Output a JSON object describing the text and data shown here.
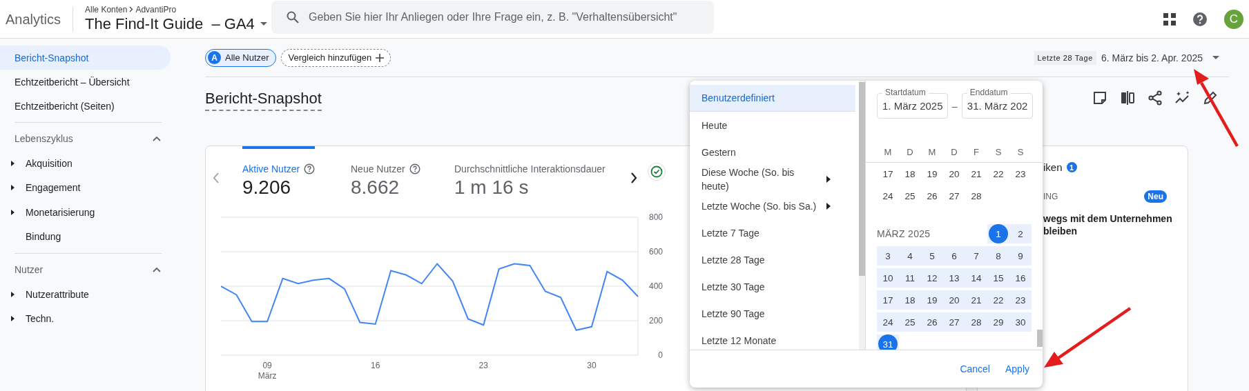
{
  "header": {
    "product": "Analytics",
    "breadcrumb": [
      "Alle Konten",
      "AdvantiPro"
    ],
    "property": "The Find-It Guide  – GA4",
    "search": {
      "placeholder": "Geben Sie hier Ihr Anliegen oder Ihre Frage ein, z. B. \"Verhaltensübersicht\""
    },
    "avatar": "C"
  },
  "sidebar": {
    "items": [
      {
        "label": "Bericht-Snapshot",
        "selected": true
      },
      {
        "label": "Echtzeitbericht – Übersicht",
        "selected": false
      },
      {
        "label": "Echtzeitbericht (Seiten)",
        "selected": false
      }
    ],
    "sections": [
      {
        "title": "Lebenszyklus",
        "expanded": true,
        "items": [
          {
            "label": "Akquisition",
            "expandable": true
          },
          {
            "label": "Engagement",
            "expandable": true
          },
          {
            "label": "Monetarisierung",
            "expandable": true
          },
          {
            "label": "Bindung",
            "expandable": false
          }
        ]
      },
      {
        "title": "Nutzer",
        "expanded": true,
        "items": [
          {
            "label": "Nutzerattribute",
            "expandable": true
          },
          {
            "label": "Techn.",
            "expandable": true
          }
        ]
      }
    ]
  },
  "toolbar": {
    "segment": {
      "letter": "A",
      "label": "Alle Nutzer"
    },
    "compare": "Vergleich hinzufügen",
    "date_preset": "Letzte 28 Tage",
    "date_range": "6. März bis 2. Apr. 2025"
  },
  "report": {
    "title": "Bericht-Snapshot"
  },
  "metrics_card": {
    "metrics": [
      {
        "label": "Aktive Nutzer",
        "value": "9.206",
        "selected": true,
        "help": true
      },
      {
        "label": "Neue Nutzer",
        "value": "8.662",
        "selected": false,
        "help": true
      },
      {
        "label": "Durchschnittliche Interaktionsdauer",
        "value": "1 m 16 s",
        "selected": false,
        "help": false
      }
    ],
    "chart_data": {
      "type": "line",
      "grid": true,
      "ylim": [
        0,
        800
      ],
      "yticks": [
        0,
        200,
        400,
        600,
        800
      ],
      "xlabel": "März",
      "categories": [
        null,
        null,
        null,
        "09",
        null,
        null,
        null,
        null,
        null,
        null,
        "16",
        null,
        null,
        null,
        null,
        null,
        null,
        "23",
        null,
        null,
        null,
        null,
        null,
        null,
        "30",
        null,
        null,
        null
      ],
      "series": [
        {
          "color": "#4285f4",
          "values": [
            400,
            350,
            195,
            195,
            445,
            415,
            435,
            445,
            385,
            190,
            180,
            490,
            465,
            415,
            530,
            430,
            210,
            175,
            500,
            530,
            520,
            370,
            335,
            145,
            165,
            485,
            435,
            340
          ]
        }
      ]
    }
  },
  "side_card": {
    "title": "iken",
    "badge": "1",
    "label": "ING",
    "tag": "Neu",
    "lines": [
      "wegs mit dem Unternehmen",
      "bleiben"
    ]
  },
  "date_picker": {
    "presets": [
      {
        "label": "Benutzerdefiniert",
        "selected": true,
        "submenu": false
      },
      {
        "label": "Heute",
        "selected": false,
        "submenu": false
      },
      {
        "label": "Gestern",
        "selected": false,
        "submenu": false
      },
      {
        "label": "Diese Woche (So. bis heute)",
        "selected": false,
        "submenu": true
      },
      {
        "label": "Letzte Woche (So. bis Sa.)",
        "selected": false,
        "submenu": true
      },
      {
        "label": "Letzte 7 Tage",
        "selected": false,
        "submenu": false
      },
      {
        "label": "Letzte 28 Tage",
        "selected": false,
        "submenu": false
      },
      {
        "label": "Letzte 30 Tage",
        "selected": false,
        "submenu": false
      },
      {
        "label": "Letzte 90 Tage",
        "selected": false,
        "submenu": false
      },
      {
        "label": "Letzte 12 Monate",
        "selected": false,
        "submenu": false
      }
    ],
    "start": {
      "label": "Startdatum",
      "value": "1. März 2025"
    },
    "separator": "–",
    "end": {
      "label": "Enddatum",
      "value": "31. März 202"
    },
    "weekdays": [
      "M",
      "D",
      "M",
      "D",
      "F",
      "S",
      "S"
    ],
    "months": [
      {
        "weeks": [
          [
            {
              "d": "17",
              "selected": false,
              "in_range": false
            },
            {
              "d": "18",
              "selected": false,
              "in_range": false
            },
            {
              "d": "19",
              "selected": false,
              "in_range": false
            },
            {
              "d": "20",
              "selected": false,
              "in_range": false
            },
            {
              "d": "21",
              "selected": false,
              "in_range": false
            },
            {
              "d": "22",
              "selected": false,
              "in_range": false
            },
            {
              "d": "23",
              "selected": false,
              "in_range": false
            }
          ],
          [
            {
              "d": "24",
              "selected": false,
              "in_range": false
            },
            {
              "d": "25",
              "selected": false,
              "in_range": false
            },
            {
              "d": "26",
              "selected": false,
              "in_range": false
            },
            {
              "d": "27",
              "selected": false,
              "in_range": false
            },
            {
              "d": "28",
              "selected": false,
              "in_range": false
            }
          ]
        ]
      },
      {
        "title": "MÄRZ 2025",
        "weeks": [
          [
            {
              "d": "1",
              "selected": true,
              "in_range": true
            },
            {
              "d": "2",
              "selected": false,
              "in_range": true
            }
          ],
          [
            {
              "d": "3",
              "selected": false,
              "in_range": true
            },
            {
              "d": "4",
              "selected": false,
              "in_range": true
            },
            {
              "d": "5",
              "selected": false,
              "in_range": true
            },
            {
              "d": "6",
              "selected": false,
              "in_range": true
            },
            {
              "d": "7",
              "selected": false,
              "in_range": true
            },
            {
              "d": "8",
              "selected": false,
              "in_range": true
            },
            {
              "d": "9",
              "selected": false,
              "in_range": true
            }
          ],
          [
            {
              "d": "10",
              "selected": false,
              "in_range": true
            },
            {
              "d": "11",
              "selected": false,
              "in_range": true
            },
            {
              "d": "12",
              "selected": false,
              "in_range": true
            },
            {
              "d": "13",
              "selected": false,
              "in_range": true
            },
            {
              "d": "14",
              "selected": false,
              "in_range": true
            },
            {
              "d": "15",
              "selected": false,
              "in_range": true
            },
            {
              "d": "16",
              "selected": false,
              "in_range": true
            }
          ],
          [
            {
              "d": "17",
              "selected": false,
              "in_range": true
            },
            {
              "d": "18",
              "selected": false,
              "in_range": true
            },
            {
              "d": "19",
              "selected": false,
              "in_range": true
            },
            {
              "d": "20",
              "selected": false,
              "in_range": true
            },
            {
              "d": "21",
              "selected": false,
              "in_range": true
            },
            {
              "d": "22",
              "selected": false,
              "in_range": true
            },
            {
              "d": "23",
              "selected": false,
              "in_range": true
            }
          ],
          [
            {
              "d": "24",
              "selected": false,
              "in_range": true
            },
            {
              "d": "25",
              "selected": false,
              "in_range": true
            },
            {
              "d": "26",
              "selected": false,
              "in_range": true
            },
            {
              "d": "27",
              "selected": false,
              "in_range": true
            },
            {
              "d": "28",
              "selected": false,
              "in_range": true
            },
            {
              "d": "29",
              "selected": false,
              "in_range": true
            },
            {
              "d": "30",
              "selected": false,
              "in_range": true
            }
          ],
          [
            {
              "d": "31",
              "selected": true,
              "in_range": true
            }
          ]
        ]
      }
    ],
    "buttons": [
      "Cancel",
      "Apply"
    ]
  }
}
